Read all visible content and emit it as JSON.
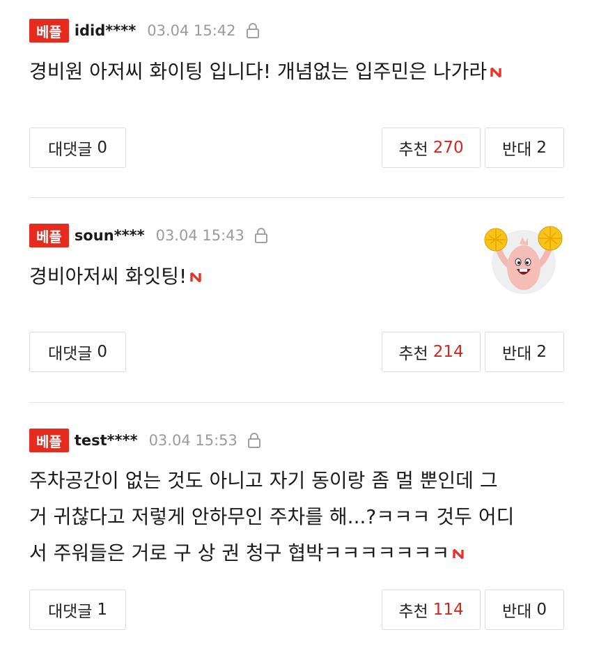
{
  "comments": [
    {
      "badge": "베플",
      "user": "idid****",
      "time": "03.04 15:42",
      "text": "경비원 아저씨 화이팅 입니다! 개념없는 입주민은 나가라",
      "reply_label": "대댓글",
      "reply_count": "0",
      "recommend_label": "추천",
      "recommend_count": "270",
      "oppose_label": "반대",
      "oppose_count": "2"
    },
    {
      "badge": "베플",
      "user": "soun****",
      "time": "03.04 15:43",
      "text": "경비아저씨 화잇팅!",
      "reply_label": "대댓글",
      "reply_count": "0",
      "recommend_label": "추천",
      "recommend_count": "214",
      "oppose_label": "반대",
      "oppose_count": "2"
    },
    {
      "badge": "베플",
      "user": "test****",
      "time": "03.04 15:53",
      "text_lines": [
        "주차공간이 없는 것도 아니고 자기 동이랑 좀 멀 뿐인데 그",
        "거 귀찮다고 저렇게 안하무인 주차를 해...?ㅋㅋㅋ 것두 어디",
        "서 주워들은 거로 구 상 권 청구 협박ㅋㅋㅋㅋㅋㅋㅋ"
      ],
      "reply_label": "대댓글",
      "reply_count": "1",
      "recommend_label": "추천",
      "recommend_count": "114",
      "oppose_label": "반대",
      "oppose_count": "0"
    }
  ],
  "colors": {
    "badge": "#e52a1e",
    "recommend_count": "#d2271c",
    "time": "#9b9b9b"
  },
  "icons": {
    "lock": "lock-icon",
    "new": "new-badge-icon",
    "sticker": "cheerleader-sticker"
  }
}
